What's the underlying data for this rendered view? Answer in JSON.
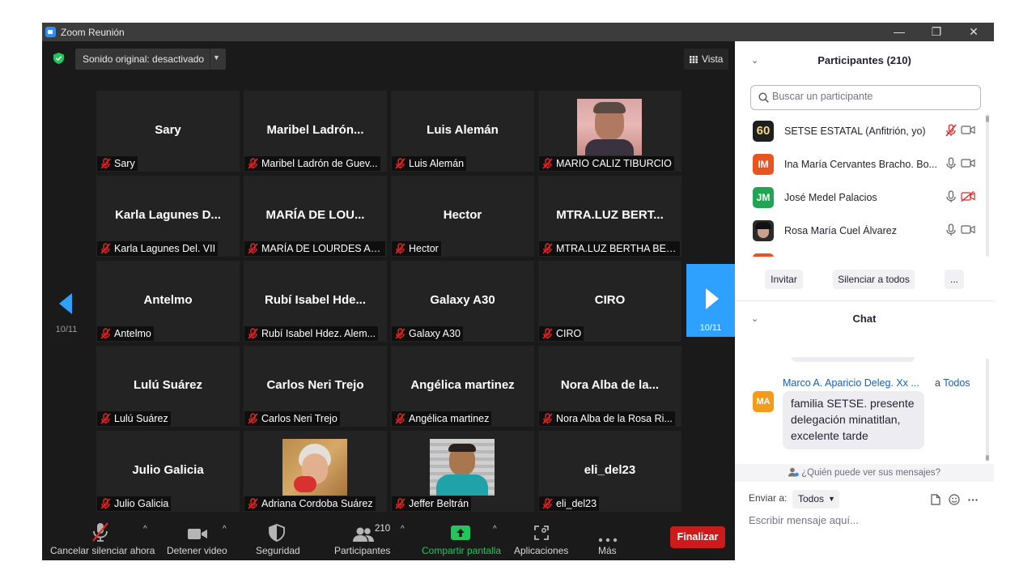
{
  "window": {
    "title": "Zoom Reunión",
    "minimize": "—",
    "restore": "❐",
    "close": "✕"
  },
  "top": {
    "audio_label": "Sonido original: desactivado",
    "view_label": "Vista"
  },
  "nav": {
    "page": "10/11"
  },
  "tiles": [
    {
      "name": "Sary",
      "label": "Sary"
    },
    {
      "name": "Maribel  Ladrón...",
      "label": "Maribel Ladrón de Guev..."
    },
    {
      "name": "Luis Alemán",
      "label": "Luis Alemán"
    },
    {
      "name": "",
      "label": "MARIO CALIZ TIBURCIO"
    },
    {
      "name": "Karla Lagunes D...",
      "label": "Karla Lagunes Del. VII"
    },
    {
      "name": "MARÍA DE LOU...",
      "label": "MARÍA DE LOURDES AG..."
    },
    {
      "name": "Hector",
      "label": "Hector"
    },
    {
      "name": "MTRA.LUZ BERT...",
      "label": "MTRA.LUZ BERTHA BECE..."
    },
    {
      "name": "Antelmo",
      "label": "Antelmo"
    },
    {
      "name": "Rubí Isabel  Hde...",
      "label": "Rubí Isabel  Hdez. Alem..."
    },
    {
      "name": "Galaxy A30",
      "label": "Galaxy A30"
    },
    {
      "name": "CIRO",
      "label": "CIRO"
    },
    {
      "name": "Lulú Suárez",
      "label": "Lulú Suárez"
    },
    {
      "name": "Carlos Neri Trejo",
      "label": "Carlos Neri Trejo"
    },
    {
      "name": "Angélica martinez",
      "label": "Angélica martinez"
    },
    {
      "name": "Nora Alba de la...",
      "label": "Nora Alba de la Rosa Ri..."
    },
    {
      "name": "Julio Galicia",
      "label": "Julio Galicia"
    },
    {
      "name": "",
      "label": "Adriana Cordoba Suárez"
    },
    {
      "name": "",
      "label": "Jeffer Beltrán"
    },
    {
      "name": "eli_del23",
      "label": "eli_del23"
    }
  ],
  "toolbar": {
    "unmute": "Cancelar silenciar ahora",
    "video": "Detener video",
    "security": "Seguridad",
    "participants": "Participantes",
    "participants_count": "210",
    "share": "Compartir pantalla",
    "apps": "Aplicaciones",
    "more": "Más",
    "end": "Finalizar"
  },
  "participants_panel": {
    "title": "Participantes (210)",
    "search_placeholder": "Buscar un participante",
    "rows": [
      {
        "avatar_text": "60",
        "avatar_color": "#1f1f1f",
        "name": "SETSE ESTATAL (Anfitrión, yo)"
      },
      {
        "avatar_text": "IM",
        "avatar_color": "#e8531f",
        "name": "Ina María Cervantes Bracho. Bo..."
      },
      {
        "avatar_text": "JM",
        "avatar_color": "#23a455",
        "name": "José Medel Palacios"
      },
      {
        "avatar_text": "",
        "avatar_color": "#2b2b2b",
        "name": "Rosa María Cuel Álvarez"
      }
    ],
    "invite": "Invitar",
    "mute_all": "Silenciar a todos",
    "more": "..."
  },
  "chat": {
    "title": "Chat",
    "sender": "Marco A. Aparicio Deleg. Xx ...",
    "to_prefix": "a",
    "to": "Todos",
    "sender_initials": "MA",
    "message": "familia SETSE. presente delegación minatitlan, excelente tarde",
    "who_can_see": "¿Quién puede ver sus mensajes?",
    "send_to_label": "Enviar a:",
    "send_to_value": "Todos",
    "input_placeholder": "Escribir mensaje aquí..."
  },
  "colors": {
    "accent": "#2ea1ff",
    "end": "#cc1b1b",
    "share": "#23c55e",
    "muted": "#e02828"
  }
}
